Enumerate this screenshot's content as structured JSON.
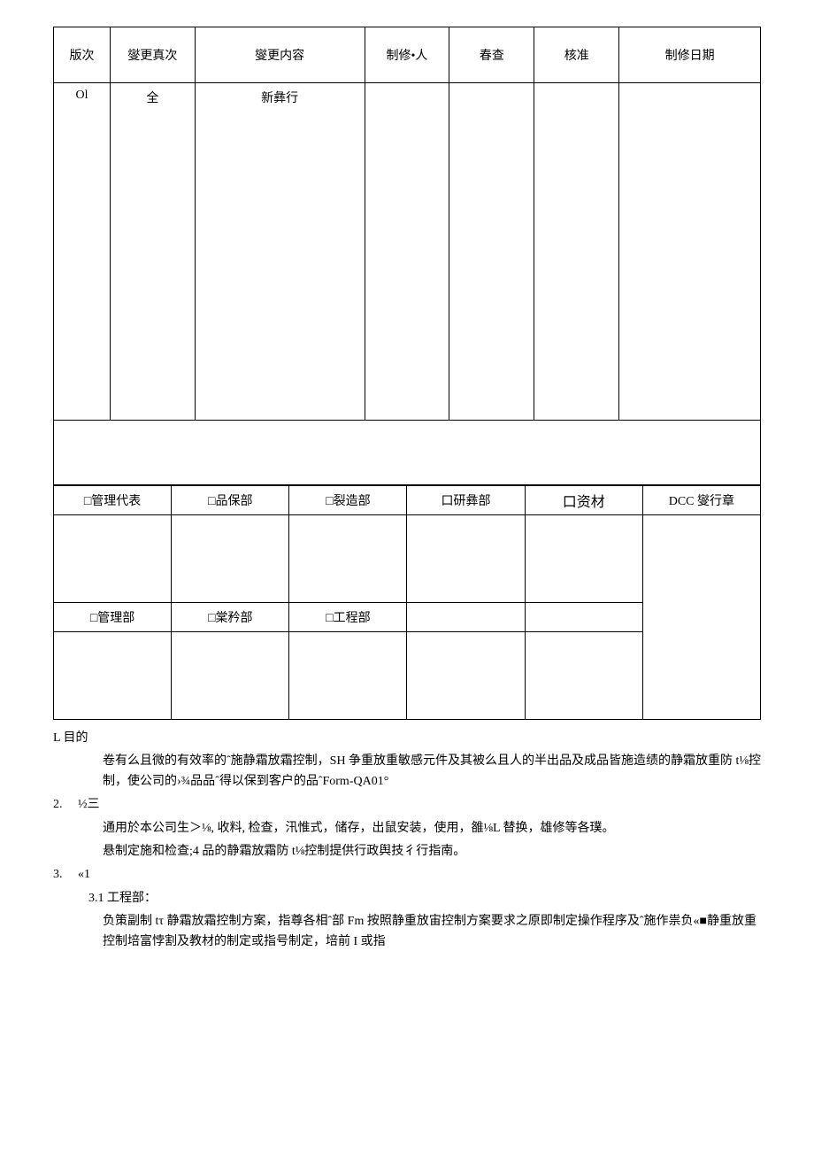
{
  "table1": {
    "headers": [
      "版次",
      "燮更真次",
      "燮更内容",
      "制修•人",
      "春查",
      "核准",
      "制修日期"
    ],
    "row": {
      "c0": "Ol",
      "c1": "全",
      "c2": "新彝行",
      "c3": "",
      "c4": "",
      "c5": "",
      "c6": ""
    }
  },
  "table2": {
    "row1": [
      "□管理代表",
      "□品保部",
      "□裂造部",
      "口研彝部",
      "口资材",
      "DCC 燮行章"
    ],
    "row2": [
      "□管理部",
      "□棠矜部",
      "□工程部"
    ]
  },
  "body": {
    "s1_title": "L 目的",
    "s1_p1": "卷有么且微的有效率的ˆ施静霜放霜控制，SH 争重放重敏感元件及其被么且人的半出品及成品皆施造绩的静霜放重防 t⅛控制，使公司的›¾品品ˆ得以保到客户的品ˆForm-QA01°",
    "s2_num": "2.",
    "s2_title": "½三",
    "s2_p1": "通用於本公司生＞⅛, 收料, 检查，汛惟式，储存，出鼠安装，使用，雒⅛L 替换，雄修等各璞。",
    "s2_p2": "悬制定施和检查;4 品的静霜放霜防 t⅛控制提供行政舆技彳行指南。",
    "s3_num": "3.",
    "s3_title": "«1",
    "s3_sub": "3.1 工程部：",
    "s3_p1": "负策副制 tτ 静霜放霜控制方案，指尊各相ˆ部 Fm 按照静重放宙控制方案要求之原即制定操作程序及ˆ施作祟负«■静重放重控制培富悖割及教材的制定或指号制定，培前 I 或指"
  }
}
